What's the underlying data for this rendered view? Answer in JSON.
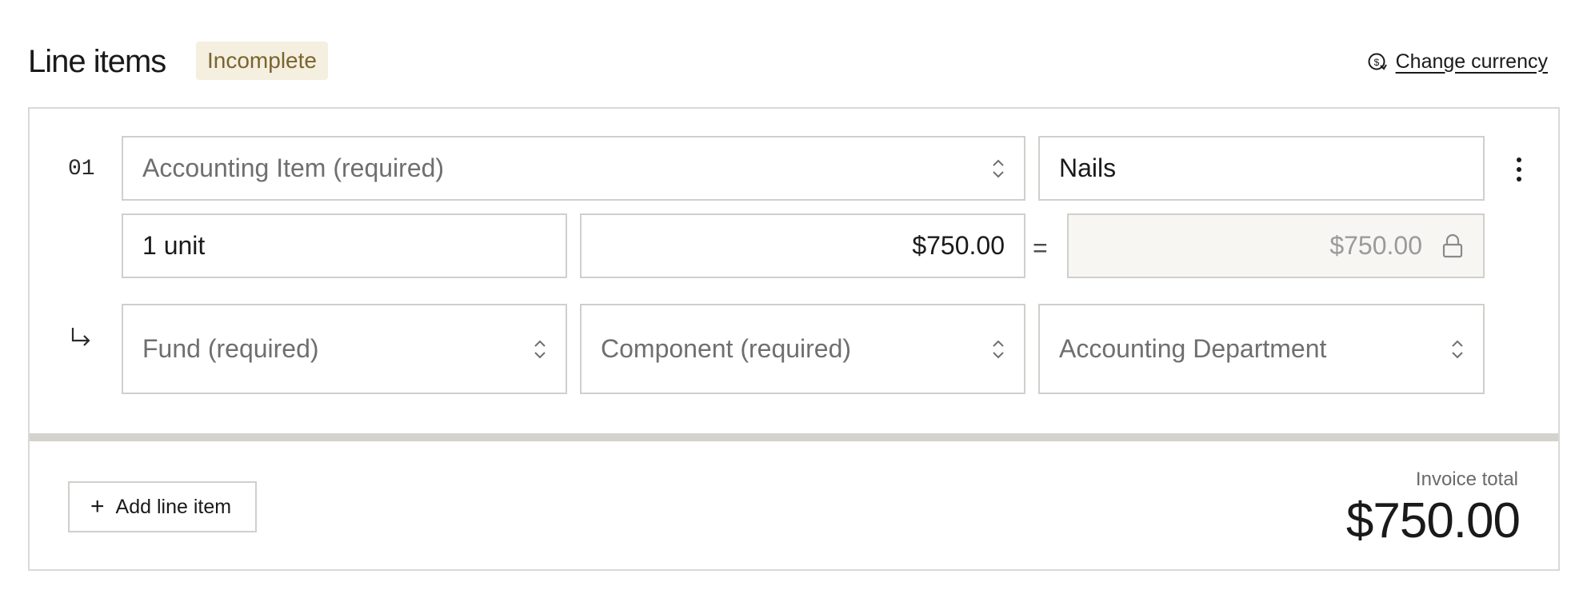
{
  "header": {
    "title": "Line items",
    "status_badge": "Incomplete",
    "change_currency_label": "Change currency"
  },
  "line_item": {
    "number": "01",
    "accounting_item_placeholder": "Accounting Item (required)",
    "description_value": "Nails",
    "quantity_value": "1 unit",
    "unit_price_value": "$750.00",
    "equals_symbol": "=",
    "line_total_value": "$750.00",
    "fund_placeholder": "Fund (required)",
    "component_placeholder": "Component (required)",
    "department_placeholder": "Accounting Department"
  },
  "footer": {
    "add_line_item_label": "Add line item",
    "invoice_total_label": "Invoice total",
    "invoice_total_value": "$750.00"
  },
  "icons": {
    "currency": "currency-exchange-icon",
    "chevron": "chevron-up-down-icon",
    "lock": "lock-icon",
    "kebab": "kebab-menu-icon",
    "subitem": "subitem-arrow-icon",
    "plus": "plus-icon"
  },
  "colors": {
    "badge_bg": "#f4efdf",
    "badge_text": "#7a6430",
    "border": "#cfcfcc",
    "divider": "#d4d2cd",
    "placeholder": "#6f6f6f"
  }
}
